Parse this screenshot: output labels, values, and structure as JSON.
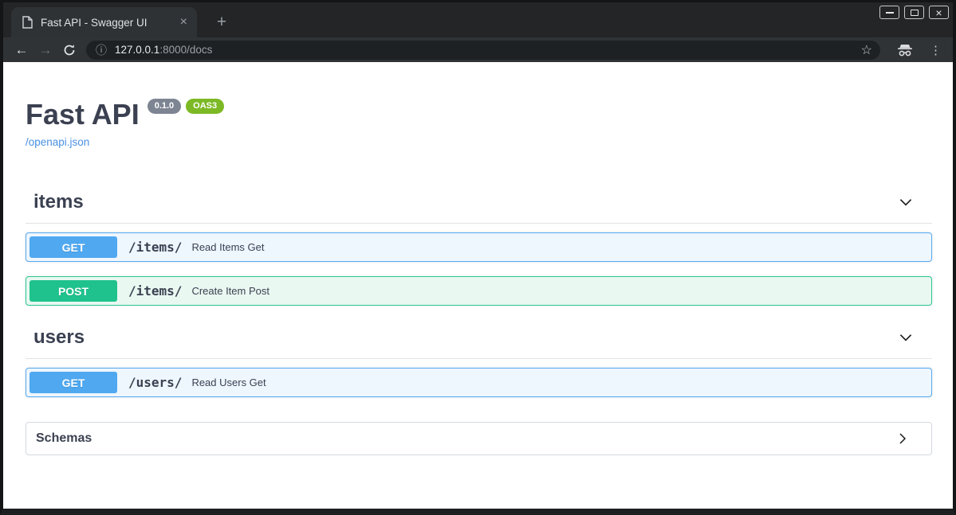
{
  "window": {
    "tab_title": "Fast API - Swagger UI"
  },
  "toolbar": {
    "url_host": "127.0.0.1",
    "url_rest": ":8000/docs"
  },
  "icons": {
    "close_x": "×",
    "plus": "+",
    "back_arrow": "←",
    "forward_arrow": "→",
    "kebab": "⋮",
    "star": "☆",
    "info": "ⓘ"
  },
  "api": {
    "title": "Fast API",
    "version_badge": "0.1.0",
    "oas_badge": "OAS3",
    "spec_link": "/openapi.json"
  },
  "sections": [
    {
      "title": "items",
      "operations": [
        {
          "method": "GET",
          "path": "/items/",
          "summary": "Read Items Get"
        },
        {
          "method": "POST",
          "path": "/items/",
          "summary": "Create Item Post"
        }
      ]
    },
    {
      "title": "users",
      "operations": [
        {
          "method": "GET",
          "path": "/users/",
          "summary": "Read Users Get"
        }
      ]
    }
  ],
  "schemas": {
    "label": "Schemas"
  },
  "colors": {
    "get_method": "#4fa8f0",
    "post_method": "#1fc28c",
    "get_row_bg": "#eef6fe",
    "post_row_bg": "#e9f8f1",
    "version_badge_bg": "#7d8492",
    "oas_badge_bg": "#7cb925",
    "link": "#4990e2",
    "heading_text": "#3b4151",
    "browser_dark": "#303336"
  }
}
